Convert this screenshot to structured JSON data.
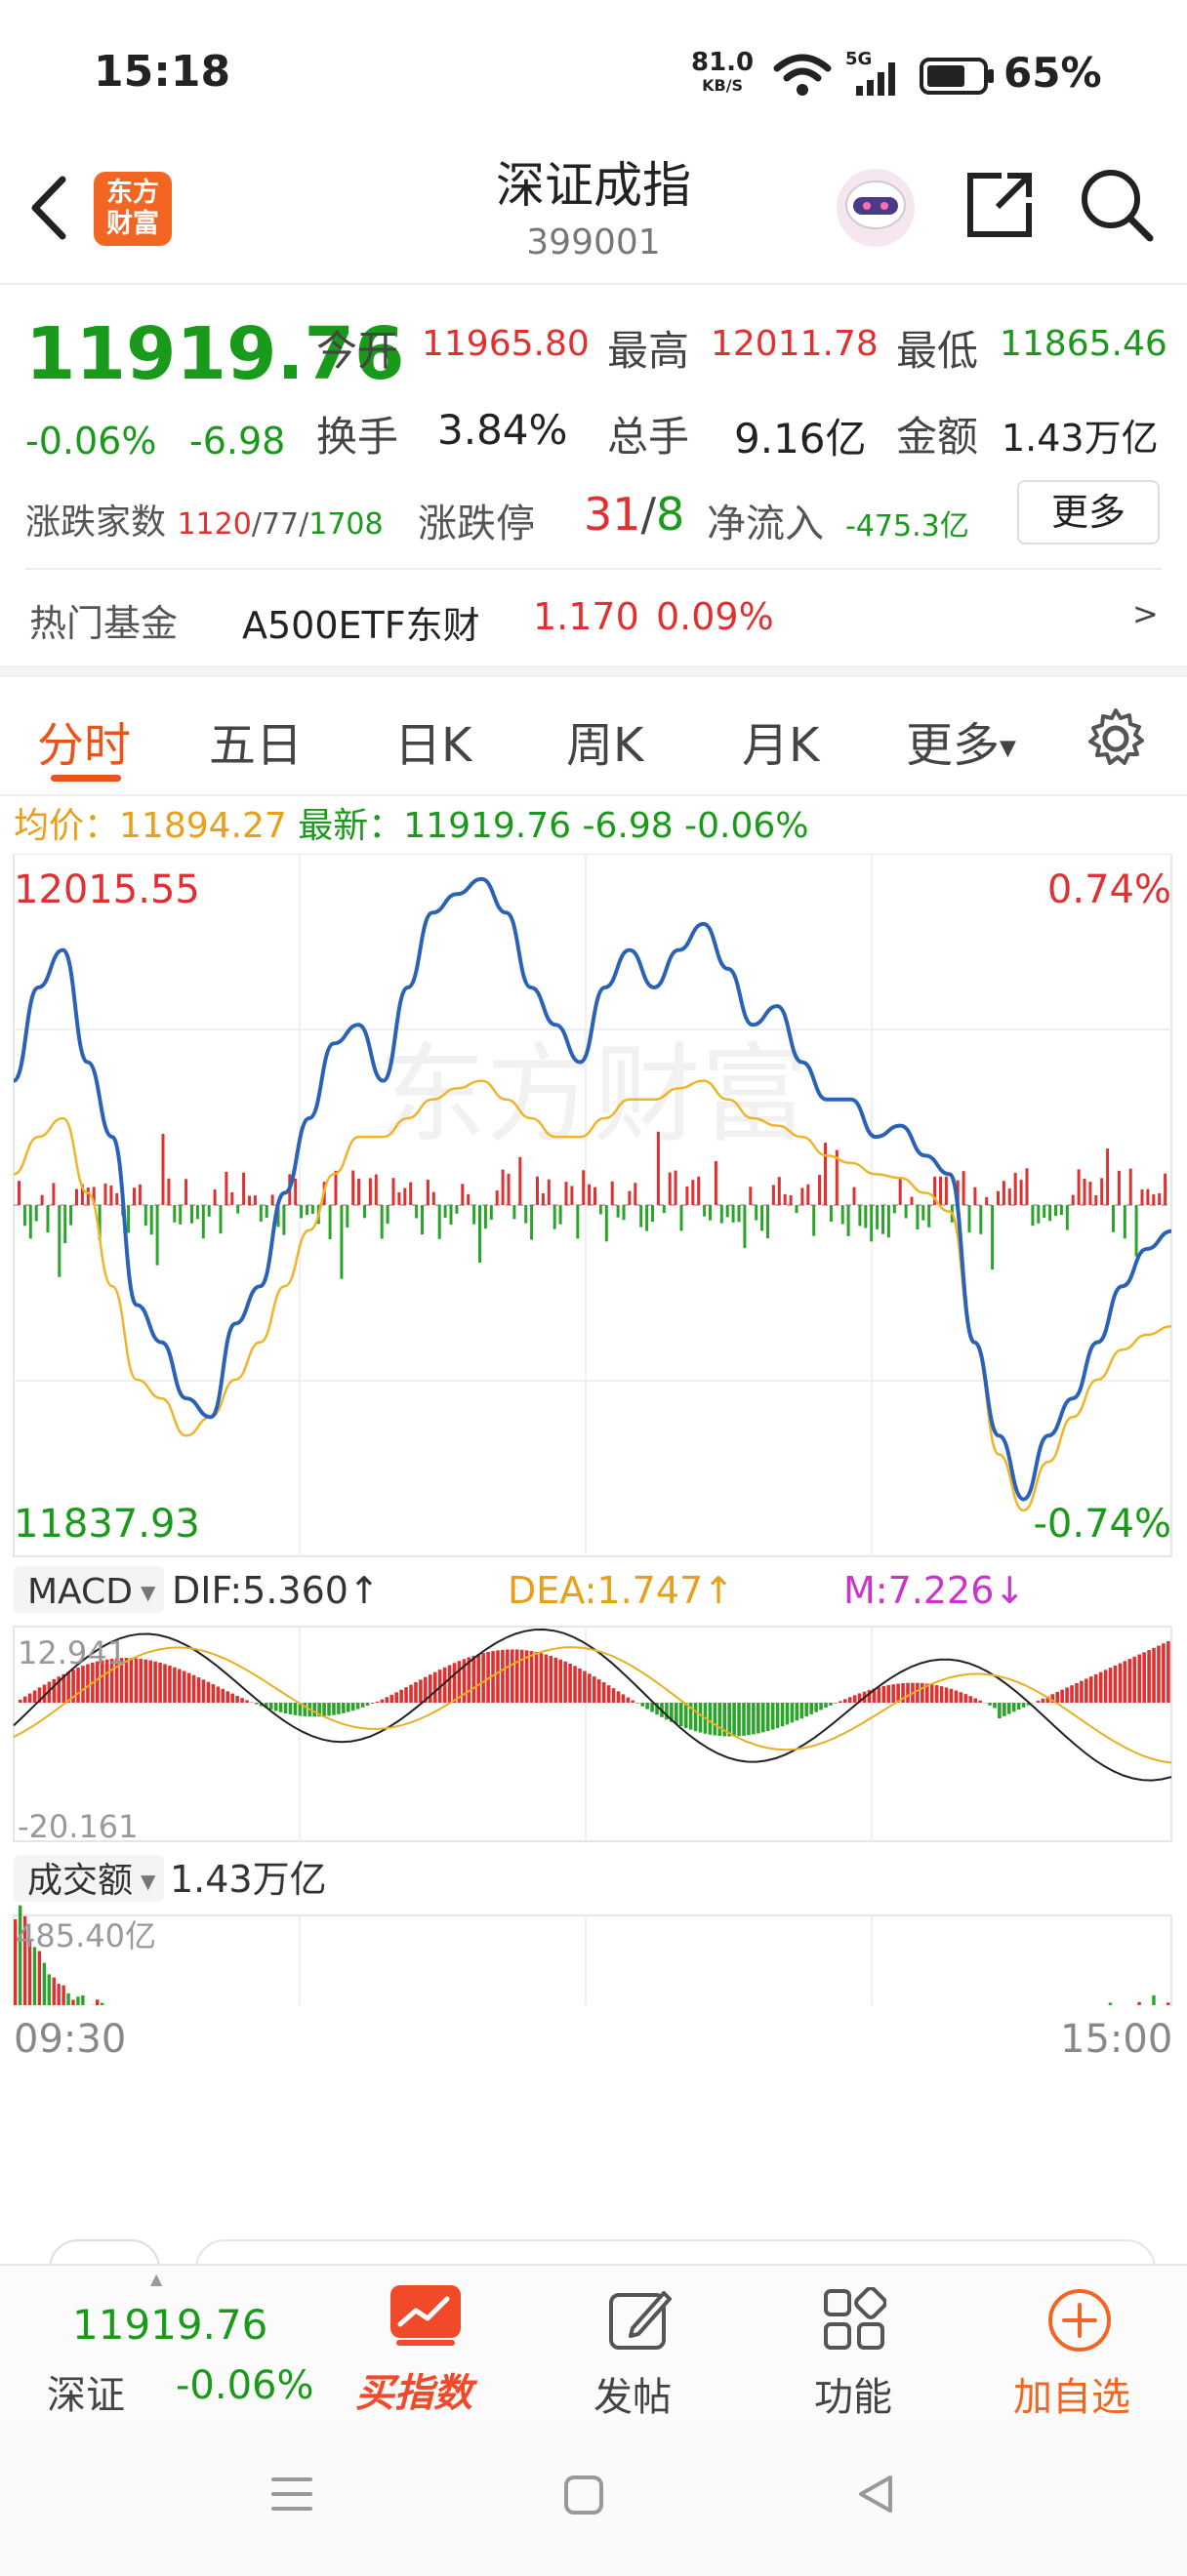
{
  "status_bar": {
    "time": "15:18",
    "net_speed": "81.0",
    "net_unit": "KB/S",
    "network": "5G",
    "battery": "65%"
  },
  "header": {
    "title": "深证成指",
    "code": "399001",
    "logo_line1": "东方",
    "logo_line2": "财富"
  },
  "quote": {
    "price": "11919.76",
    "change_pct": "-0.06%",
    "change": "-6.98",
    "open_label": "今开",
    "open": "11965.80",
    "high_label": "最高",
    "high": "12011.78",
    "low_label": "最低",
    "low": "11865.46",
    "turnover_label": "换手",
    "turnover": "3.84%",
    "volume_label": "总手",
    "volume": "9.16亿",
    "amount_label": "金额",
    "amount": "1.43万亿",
    "breadth_label": "涨跌家数",
    "breadth_up": "1120",
    "breadth_sep1": "/",
    "breadth_flat": "77",
    "breadth_sep2": "/",
    "breadth_down": "1708",
    "limit_label": "涨跌停",
    "limit_up": "31",
    "limit_sep": "/",
    "limit_down": "8",
    "netflow_label": "净流入",
    "netflow": "-475.3亿",
    "more_button": "更多"
  },
  "hot_fund": {
    "label": "热门基金",
    "name": "A500ETF东财",
    "price": "1.170",
    "pct": "0.09%",
    "arrow": ">"
  },
  "tabs": [
    {
      "label": "分时"
    },
    {
      "label": "五日"
    },
    {
      "label": "日K"
    },
    {
      "label": "周K"
    },
    {
      "label": "月K"
    },
    {
      "label": "更多"
    }
  ],
  "info_line": {
    "avg_label": "均价：",
    "avg": "11894.27",
    "latest_label": "最新：",
    "latest": "11919.76",
    "chg": "-6.98",
    "pct": "-0.06%"
  },
  "chart_labels": {
    "max": "12015.55",
    "min": "11837.93",
    "max_pct": "0.74%",
    "min_pct": "-0.74%",
    "watermark": "东方财富"
  },
  "macd": {
    "selector": "MACD",
    "dif": "DIF:5.360↑",
    "dea": "DEA:1.747↑",
    "m": "M:7.226↓",
    "top": "12.941",
    "bottom": "-20.161"
  },
  "volume_panel": {
    "selector": "成交额",
    "total": "1.43万亿",
    "max": "485.40亿",
    "time_start": "09:30",
    "time_end": "15:00"
  },
  "bottom_bar": {
    "price": "11919.76",
    "name": "深证",
    "pct": "-0.06%",
    "buy_index": "买指数",
    "post": "发帖",
    "functions": "功能",
    "add_watch": "加自选"
  },
  "colors": {
    "up": "#e03030",
    "down": "#1a9a1a",
    "price_line": "#2a62b8",
    "avg_line": "#f0b429",
    "accent": "#f26522"
  },
  "chart_data": {
    "type": "line",
    "x_range": [
      "09:30",
      "15:00"
    ],
    "ylim": [
      11837.93,
      12015.55
    ],
    "pct_range": [
      -0.74,
      0.74
    ],
    "series": [
      {
        "name": "最新",
        "values": [
          11960,
          11985,
          11995,
          11965,
          11945,
          11900,
          11890,
          11875,
          11870,
          11895,
          11905,
          11930,
          11950,
          11970,
          11975,
          11960,
          11985,
          12005,
          12010,
          12014,
          12005,
          11985,
          11975,
          11965,
          11985,
          11995,
          11985,
          11995,
          12002,
          11990,
          11975,
          11980,
          11965,
          11955,
          11955,
          11945,
          11948,
          11940,
          11935,
          11890,
          11865,
          11848,
          11865,
          11875,
          11890,
          11905,
          11915,
          11919.76
        ]
      },
      {
        "name": "均价",
        "values": [
          11935,
          11945,
          11950,
          11930,
          11905,
          11880,
          11875,
          11865,
          11870,
          11880,
          11890,
          11905,
          11920,
          11935,
          11945,
          11945,
          11950,
          11955,
          11958,
          11960,
          11955,
          11950,
          11945,
          11945,
          11950,
          11955,
          11955,
          11958,
          11960,
          11955,
          11950,
          11948,
          11945,
          11940,
          11938,
          11935,
          11934,
          11930,
          11925,
          11890,
          11860,
          11845,
          11858,
          11870,
          11880,
          11888,
          11892,
          11894.27
        ]
      }
    ]
  }
}
